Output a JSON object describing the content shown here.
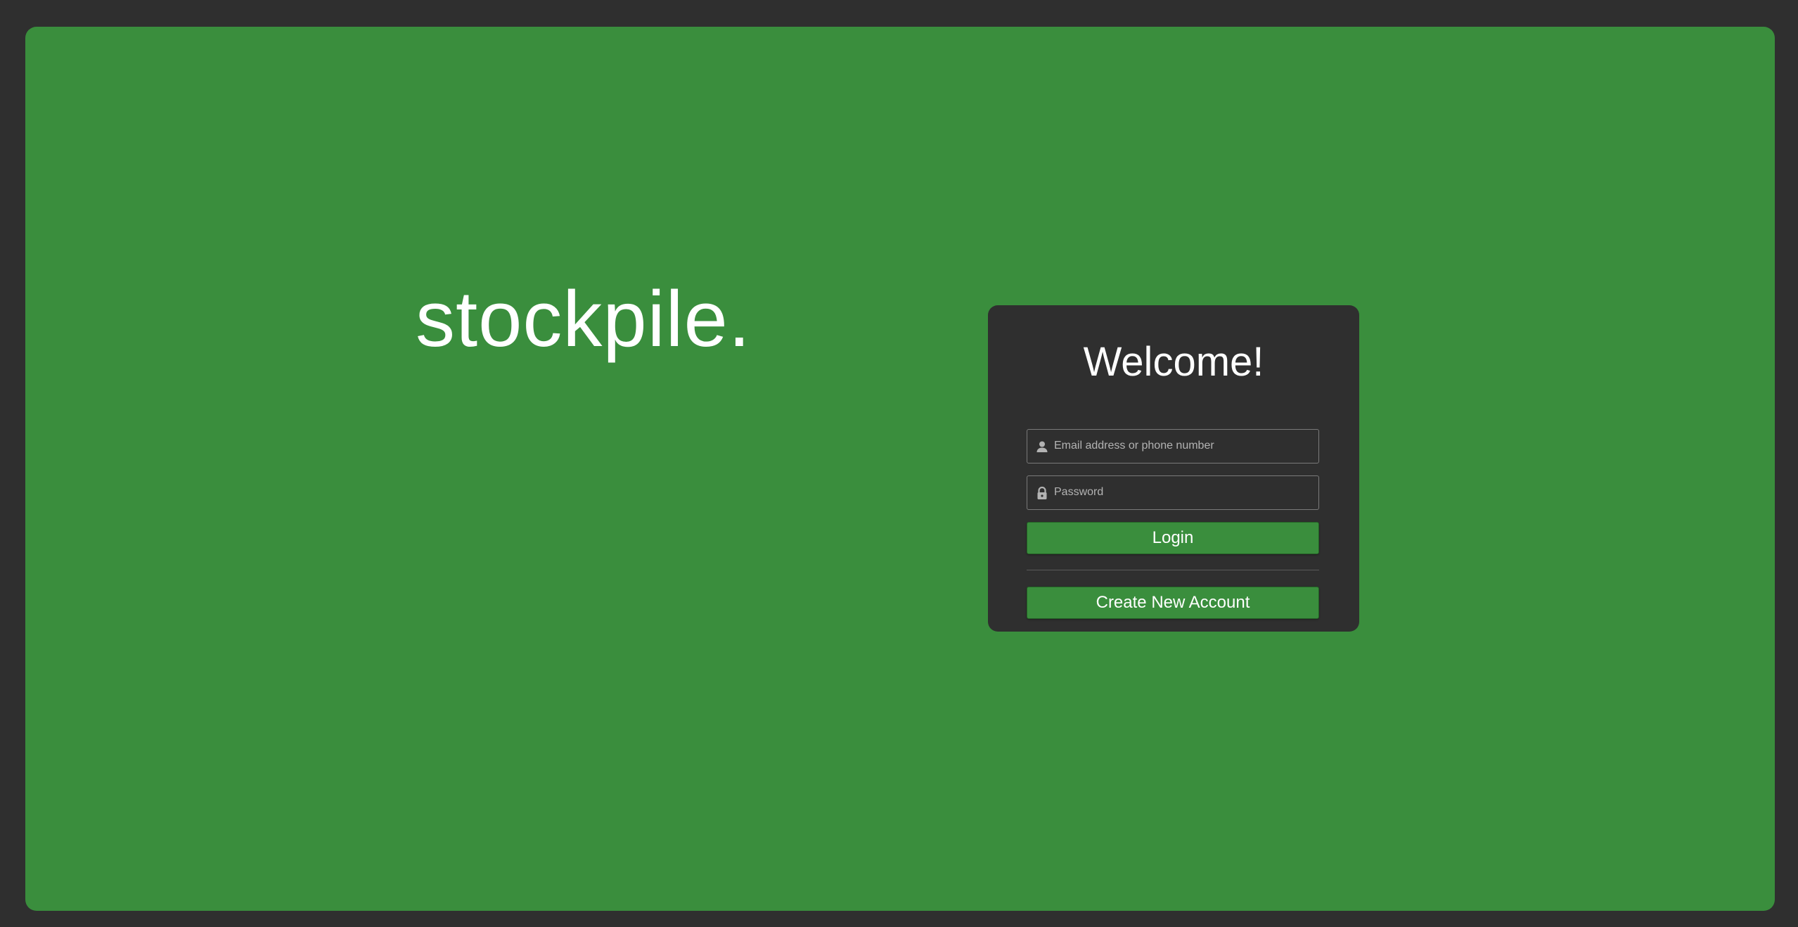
{
  "brand": {
    "name": "stockpile."
  },
  "login_card": {
    "title": "Welcome!",
    "email": {
      "placeholder": "Email address or phone number",
      "value": "",
      "icon": "user-icon"
    },
    "password": {
      "placeholder": "Password",
      "value": "",
      "icon": "lock-icon"
    },
    "login_label": "Login",
    "create_label": "Create New Account"
  },
  "colors": {
    "page_background": "#2f2f2f",
    "panel_green": "#3a8e3d",
    "card_background": "#2f2f2f",
    "text_primary": "#ffffff",
    "placeholder_text": "#b3b3b3"
  }
}
